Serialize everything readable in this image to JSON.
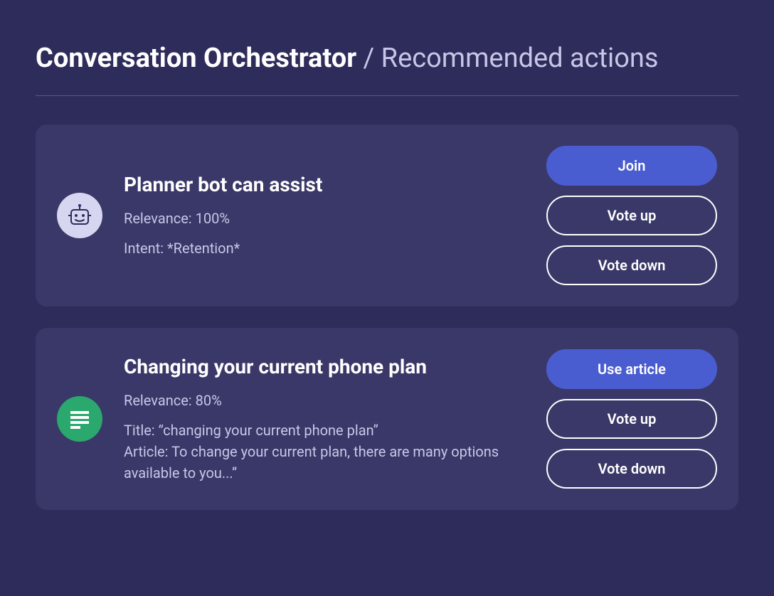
{
  "header": {
    "title_bold": "Conversation Orchestrator",
    "title_rest": " / Recommended actions"
  },
  "cards": [
    {
      "icon": "bot-icon",
      "title": "Planner bot can assist",
      "relevance": "Relevance: 100%",
      "intent": "Intent: *Retention*",
      "extra": "",
      "primary_action": "Join",
      "vote_up": "Vote up",
      "vote_down": "Vote down"
    },
    {
      "icon": "document-icon",
      "title": "Changing your current phone plan",
      "relevance": "Relevance: 80%",
      "intent": "Title: “changing your current phone plan”",
      "extra": "Article: To change your current plan, there are many options available to you...”",
      "primary_action": "Use article",
      "vote_up": "Vote up",
      "vote_down": "Vote down"
    }
  ]
}
